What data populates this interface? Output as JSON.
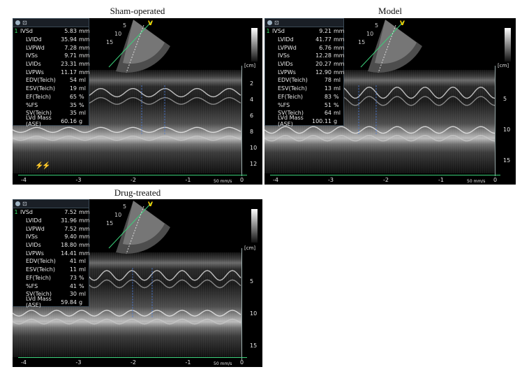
{
  "panels": [
    {
      "title": "Sham-operated",
      "rows": [
        {
          "idx": "1",
          "label": "IVSd",
          "value": "5.83",
          "unit": "mm"
        },
        {
          "idx": "",
          "label": "LVIDd",
          "value": "35.94",
          "unit": "mm"
        },
        {
          "idx": "",
          "label": "LVPWd",
          "value": "7.28",
          "unit": "mm"
        },
        {
          "idx": "",
          "label": "IVSs",
          "value": "9.71",
          "unit": "mm"
        },
        {
          "idx": "",
          "label": "LVIDs",
          "value": "23.31",
          "unit": "mm"
        },
        {
          "idx": "",
          "label": "LVPWs",
          "value": "11.17",
          "unit": "mm"
        },
        {
          "idx": "",
          "label": "EDV(Teich)",
          "value": "54",
          "unit": "ml"
        },
        {
          "idx": "",
          "label": "ESV(Teich)",
          "value": "19",
          "unit": "ml"
        },
        {
          "idx": "",
          "label": "EF(Teich)",
          "value": "65",
          "unit": "%"
        },
        {
          "idx": "",
          "label": "%FS",
          "value": "35",
          "unit": "%"
        },
        {
          "idx": "",
          "label": "SV(Teich)",
          "value": "35",
          "unit": "ml"
        },
        {
          "idx": "",
          "label": "LVd Mass (ASE)",
          "value": "60.16",
          "unit": "g"
        }
      ],
      "sector_labels": [
        "5",
        "10",
        "15"
      ],
      "depth_unit": "[cm]",
      "depth_ticks": [
        "2",
        "4",
        "6",
        "8",
        "10",
        "12"
      ],
      "time_ticks": [
        "-4",
        "-3",
        "-2",
        "-1",
        "0"
      ],
      "speed": "50 mm/s",
      "v_marker": "V"
    },
    {
      "title": "Model",
      "rows": [
        {
          "idx": "1",
          "label": "IVSd",
          "value": "9.21",
          "unit": "mm"
        },
        {
          "idx": "",
          "label": "LVIDd",
          "value": "41.77",
          "unit": "mm"
        },
        {
          "idx": "",
          "label": "LVPWd",
          "value": "6.76",
          "unit": "mm"
        },
        {
          "idx": "",
          "label": "IVSs",
          "value": "12.28",
          "unit": "mm"
        },
        {
          "idx": "",
          "label": "LVIDs",
          "value": "20.27",
          "unit": "mm"
        },
        {
          "idx": "",
          "label": "LVPWs",
          "value": "12.90",
          "unit": "mm"
        },
        {
          "idx": "",
          "label": "EDV(Teich)",
          "value": "78",
          "unit": "ml"
        },
        {
          "idx": "",
          "label": "ESV(Teich)",
          "value": "13",
          "unit": "ml"
        },
        {
          "idx": "",
          "label": "EF(Teich)",
          "value": "83",
          "unit": "%"
        },
        {
          "idx": "",
          "label": "%FS",
          "value": "51",
          "unit": "%"
        },
        {
          "idx": "",
          "label": "SV(Teich)",
          "value": "64",
          "unit": "ml"
        },
        {
          "idx": "",
          "label": "LVd Mass (ASE)",
          "value": "100.11",
          "unit": "g"
        }
      ],
      "sector_labels": [
        "5",
        "10",
        "15"
      ],
      "depth_unit": "[cm]",
      "depth_ticks": [
        "5",
        "10",
        "15"
      ],
      "time_ticks": [
        "-4",
        "-3",
        "-2",
        "-1",
        "0"
      ],
      "speed": "50 mm/s",
      "v_marker": "V"
    },
    {
      "title": "Drug-treated",
      "rows": [
        {
          "idx": "1",
          "label": "IVSd",
          "value": "7.52",
          "unit": "mm"
        },
        {
          "idx": "",
          "label": "LVIDd",
          "value": "31.96",
          "unit": "mm"
        },
        {
          "idx": "",
          "label": "LVPWd",
          "value": "7.52",
          "unit": "mm"
        },
        {
          "idx": "",
          "label": "IVSs",
          "value": "9.40",
          "unit": "mm"
        },
        {
          "idx": "",
          "label": "LVIDs",
          "value": "18.80",
          "unit": "mm"
        },
        {
          "idx": "",
          "label": "LVPWs",
          "value": "14.41",
          "unit": "mm"
        },
        {
          "idx": "",
          "label": "EDV(Teich)",
          "value": "41",
          "unit": "ml"
        },
        {
          "idx": "",
          "label": "ESV(Teich)",
          "value": "11",
          "unit": "ml"
        },
        {
          "idx": "",
          "label": "EF(Teich)",
          "value": "73",
          "unit": "%"
        },
        {
          "idx": "",
          "label": "%FS",
          "value": "41",
          "unit": "%"
        },
        {
          "idx": "",
          "label": "SV(Teich)",
          "value": "30",
          "unit": "ml"
        },
        {
          "idx": "",
          "label": "LVd Mass (ASE)",
          "value": "59.84",
          "unit": "g"
        }
      ],
      "sector_labels": [
        "5",
        "10",
        "15"
      ],
      "depth_unit": "[cm]",
      "depth_ticks": [
        "5",
        "10",
        "15"
      ],
      "time_ticks": [
        "-4",
        "-3",
        "-2",
        "-1",
        "0"
      ],
      "speed": "50 mm/s",
      "v_marker": "V"
    }
  ],
  "colors": {
    "index_green": "#38e36b",
    "timeline_green": "#3bd07a",
    "v_marker_yellow": "#ffd500",
    "ecg_red": "#ff2a2a"
  }
}
